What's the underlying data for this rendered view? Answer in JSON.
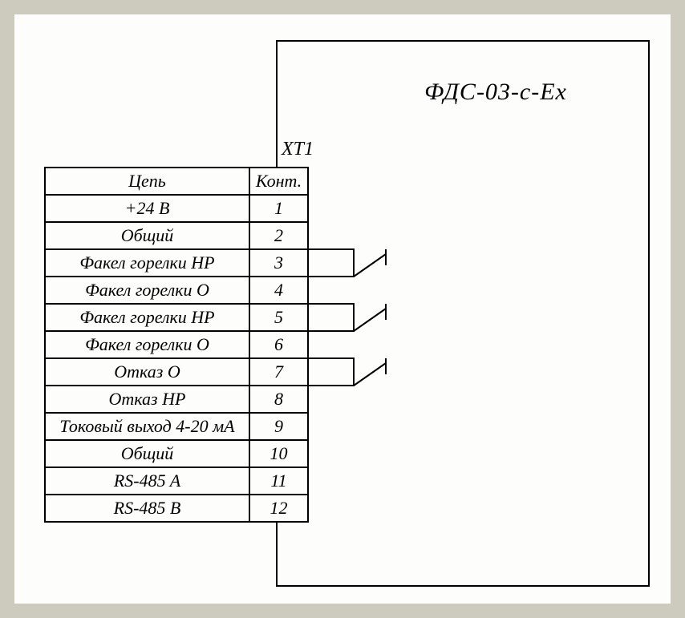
{
  "title": "ФДС-03-с-Ex",
  "connector_label": "XT1",
  "header": {
    "circuit": "Цепь",
    "contact": "Конт."
  },
  "rows": [
    {
      "circuit": "+24 В",
      "contact": "1"
    },
    {
      "circuit": "Общий",
      "contact": "2"
    },
    {
      "circuit": "Факел горелки НР",
      "contact": "3"
    },
    {
      "circuit": "Факел горелки О",
      "contact": "4"
    },
    {
      "circuit": "Факел горелки НР",
      "contact": "5"
    },
    {
      "circuit": "Факел горелки О",
      "contact": "6"
    },
    {
      "circuit": "Отказ О",
      "contact": "7"
    },
    {
      "circuit": "Отказ НР",
      "contact": "8"
    },
    {
      "circuit": "Токовый выход 4-20 мА",
      "contact": "9"
    },
    {
      "circuit": "Общий",
      "contact": "10"
    },
    {
      "circuit": "RS-485 A",
      "contact": "11"
    },
    {
      "circuit": "RS-485 B",
      "contact": "12"
    }
  ],
  "switches": [
    {
      "between_contacts": [
        3,
        4
      ]
    },
    {
      "between_contacts": [
        5,
        6
      ]
    },
    {
      "between_contacts": [
        7,
        8
      ]
    }
  ]
}
